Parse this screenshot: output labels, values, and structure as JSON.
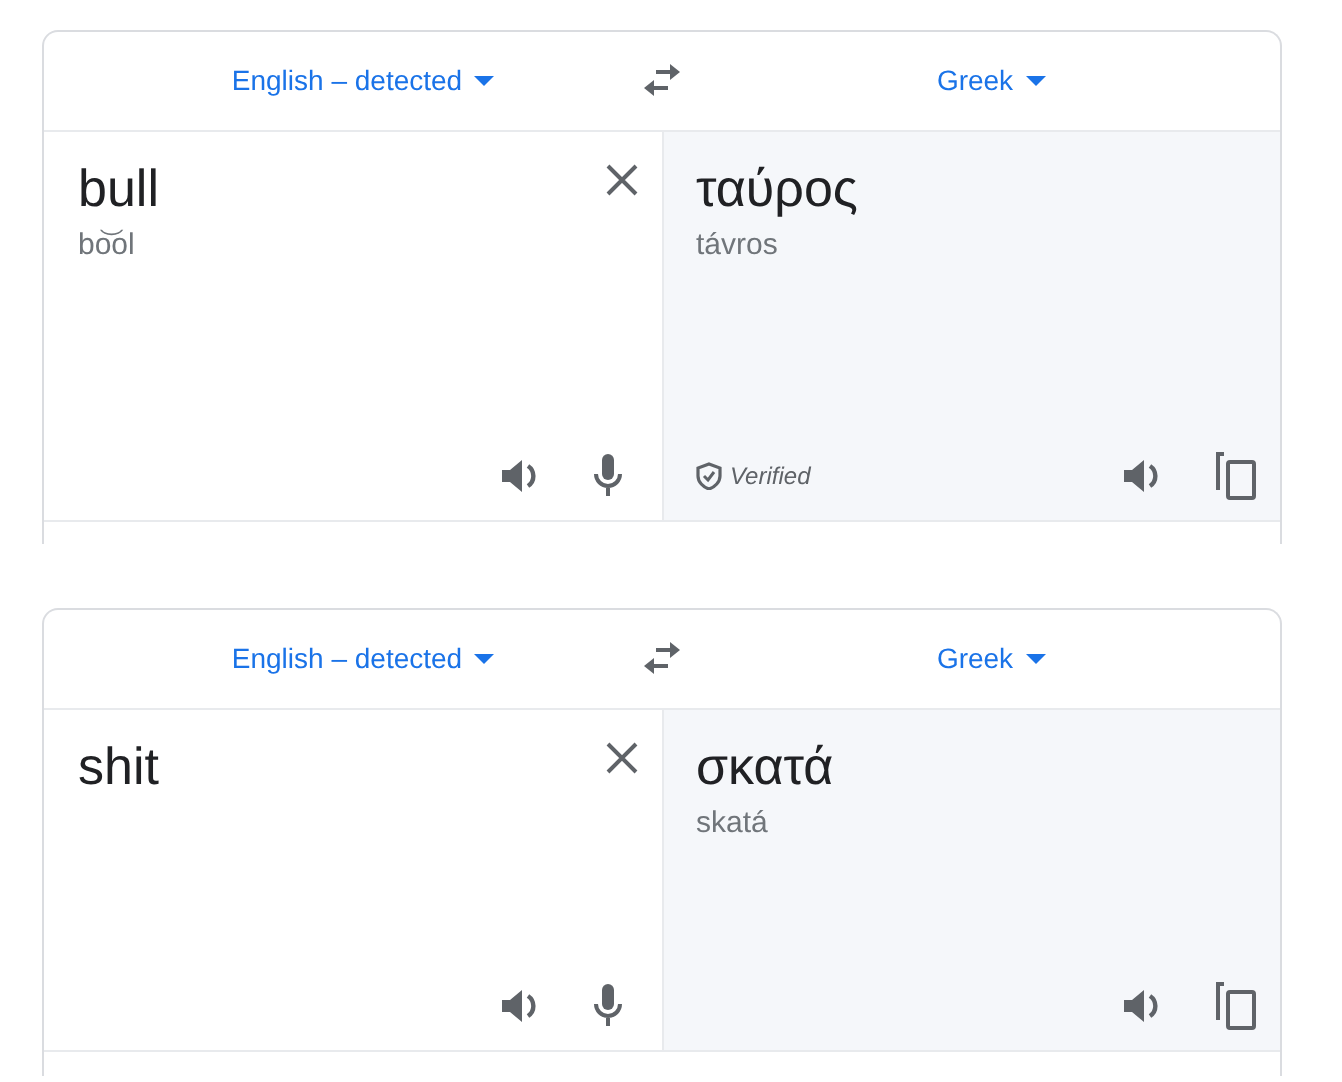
{
  "cards": [
    {
      "source_language": "English – detected",
      "target_language": "Greek",
      "input": "bull",
      "pronunciation": "bo͝ol",
      "translation": "ταύρος",
      "romanization": "távros",
      "badge": "Verified"
    },
    {
      "source_language": "English – detected",
      "target_language": "Greek",
      "input": "shit",
      "translation": "σκατά",
      "romanization": "skatá"
    }
  ]
}
